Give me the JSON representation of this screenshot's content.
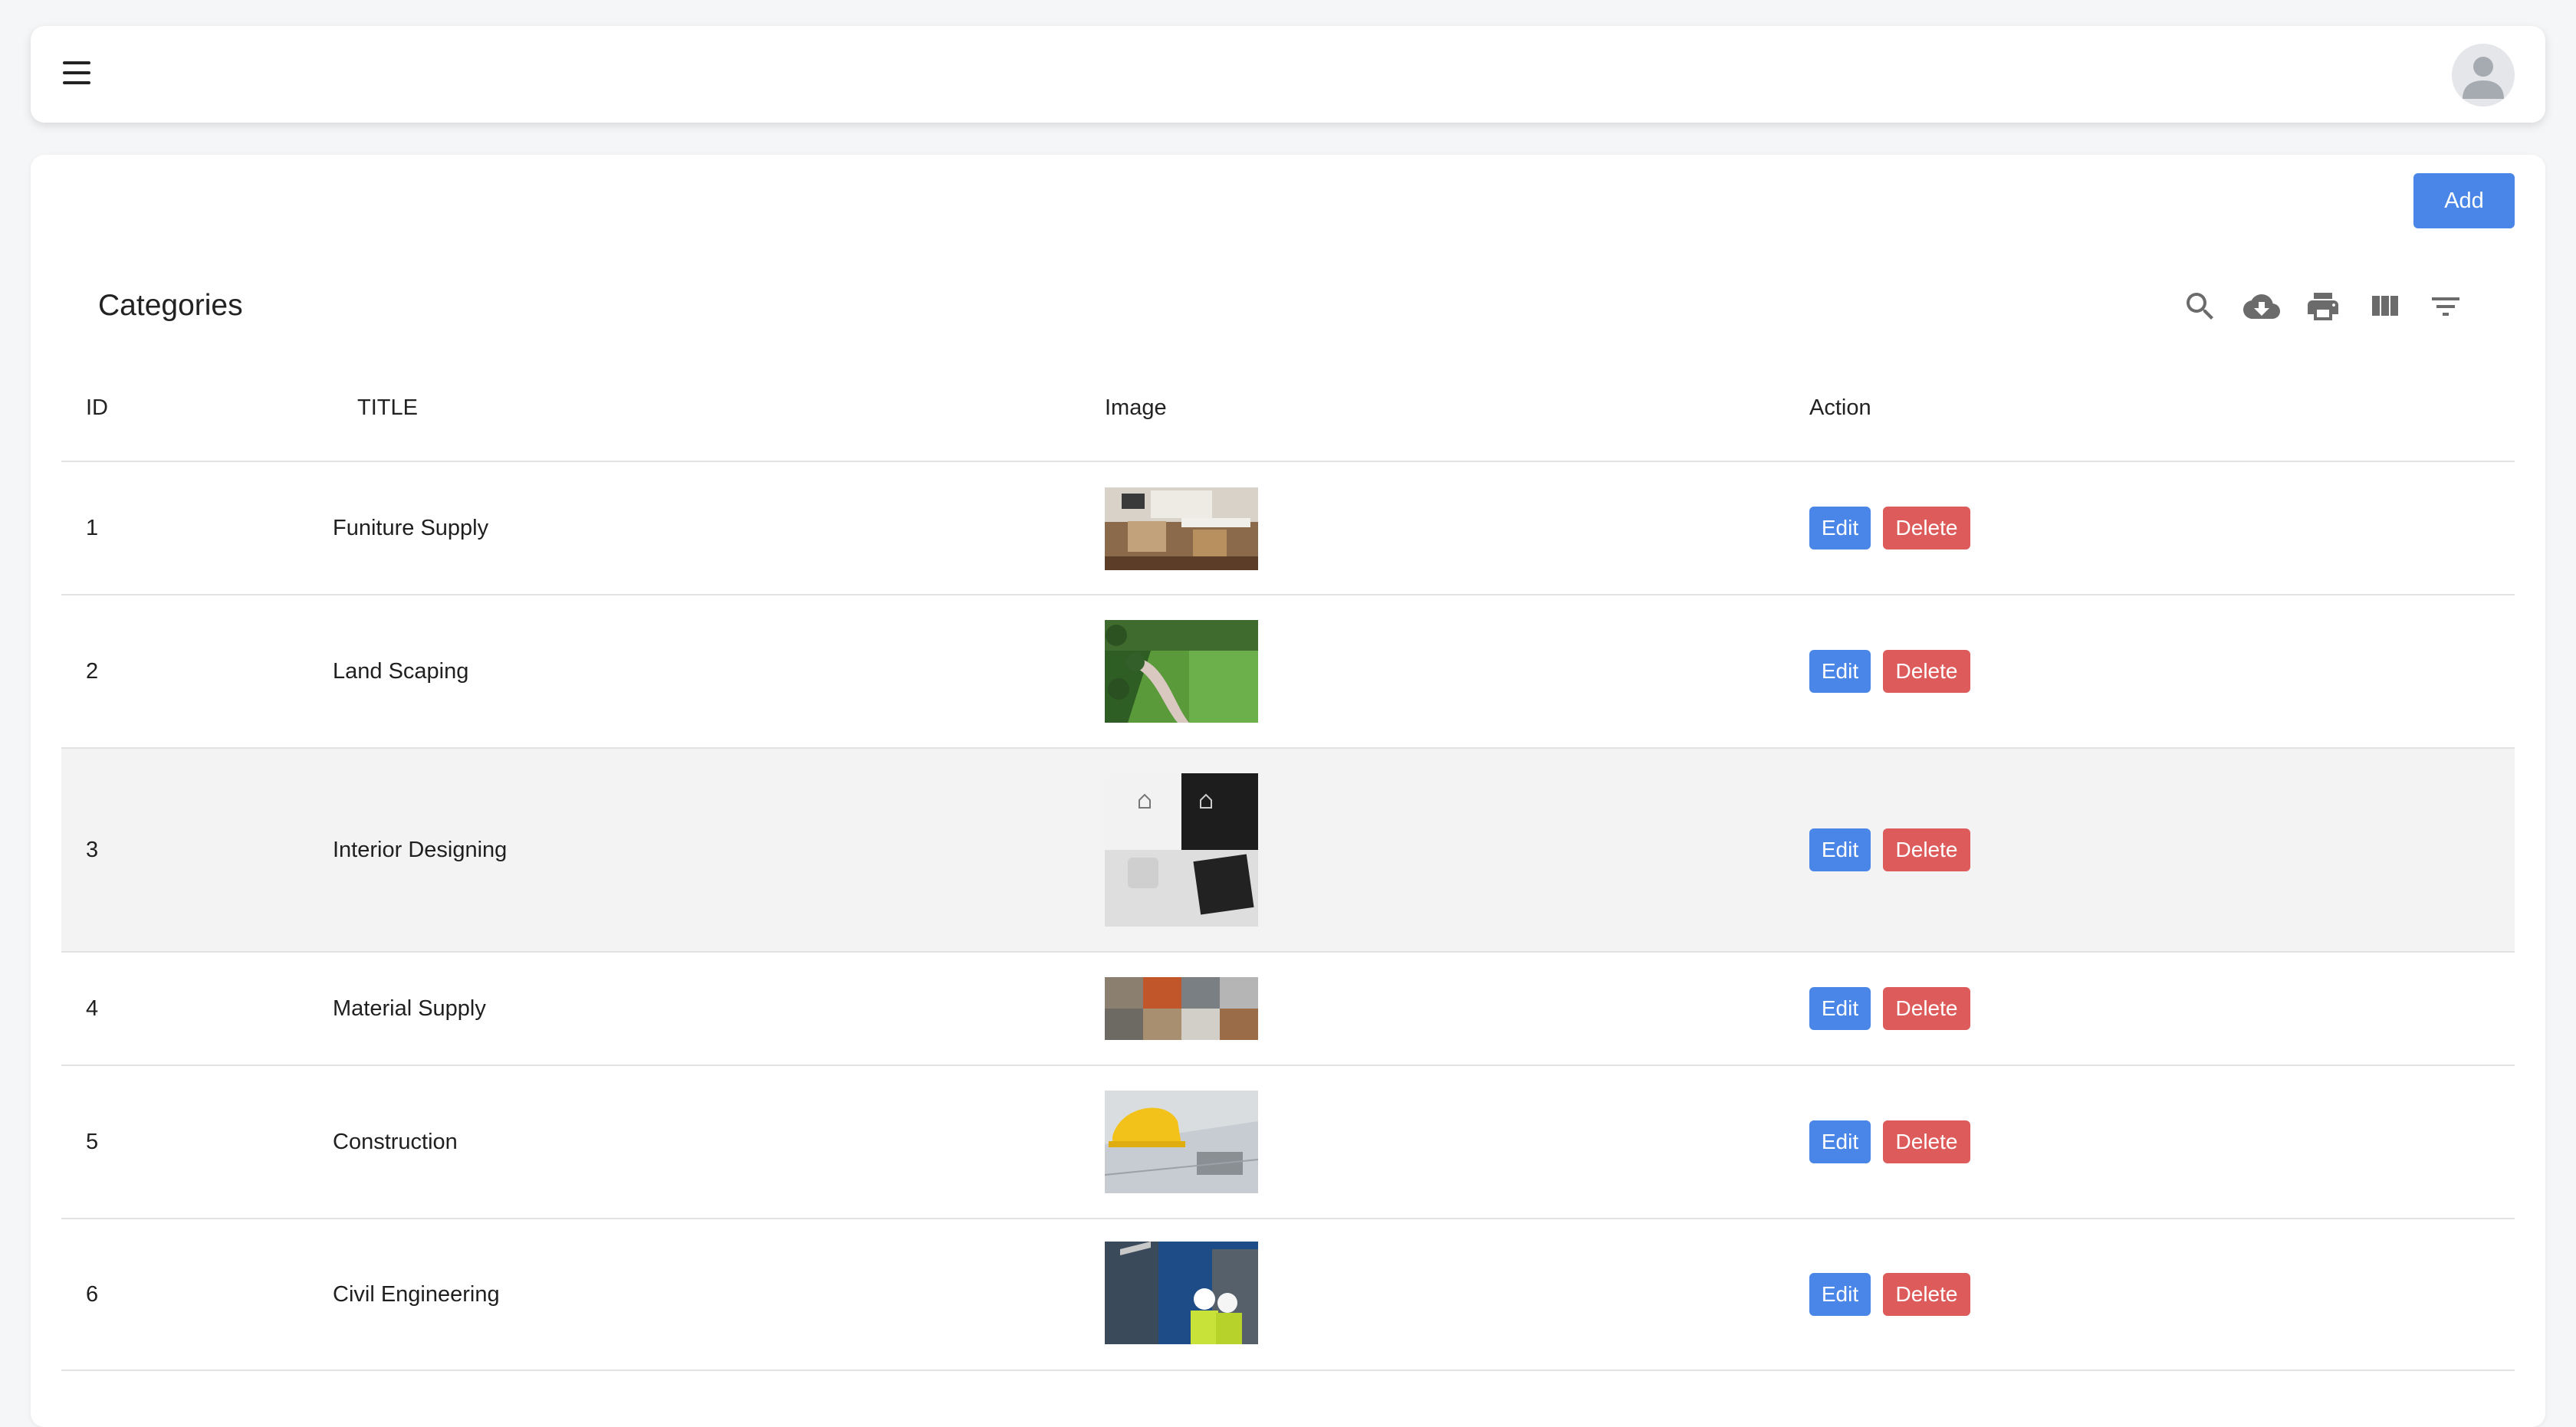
{
  "header": {
    "menu_icon": "hamburger-menu-icon",
    "avatar_icon": "user-avatar-icon"
  },
  "toolbar": {
    "add_label": "Add"
  },
  "table": {
    "title": "Categories",
    "icons": [
      "search-icon",
      "cloud-download-icon",
      "print-icon",
      "view-columns-icon",
      "filter-icon"
    ],
    "columns": {
      "id": "ID",
      "title": "TITLE",
      "image": "Image",
      "action": "Action"
    },
    "edit_label": "Edit",
    "delete_label": "Delete",
    "rows": [
      {
        "id": "1",
        "title": "Funiture Supply"
      },
      {
        "id": "2",
        "title": "Land Scaping"
      },
      {
        "id": "3",
        "title": "Interior Designing"
      },
      {
        "id": "4",
        "title": "Material Supply"
      },
      {
        "id": "5",
        "title": "Construction"
      },
      {
        "id": "6",
        "title": "Civil Engineering"
      }
    ]
  },
  "colors": {
    "primary": "#4a86e8",
    "danger": "#de5b5b",
    "highlight_row": "#f3f3f3"
  }
}
